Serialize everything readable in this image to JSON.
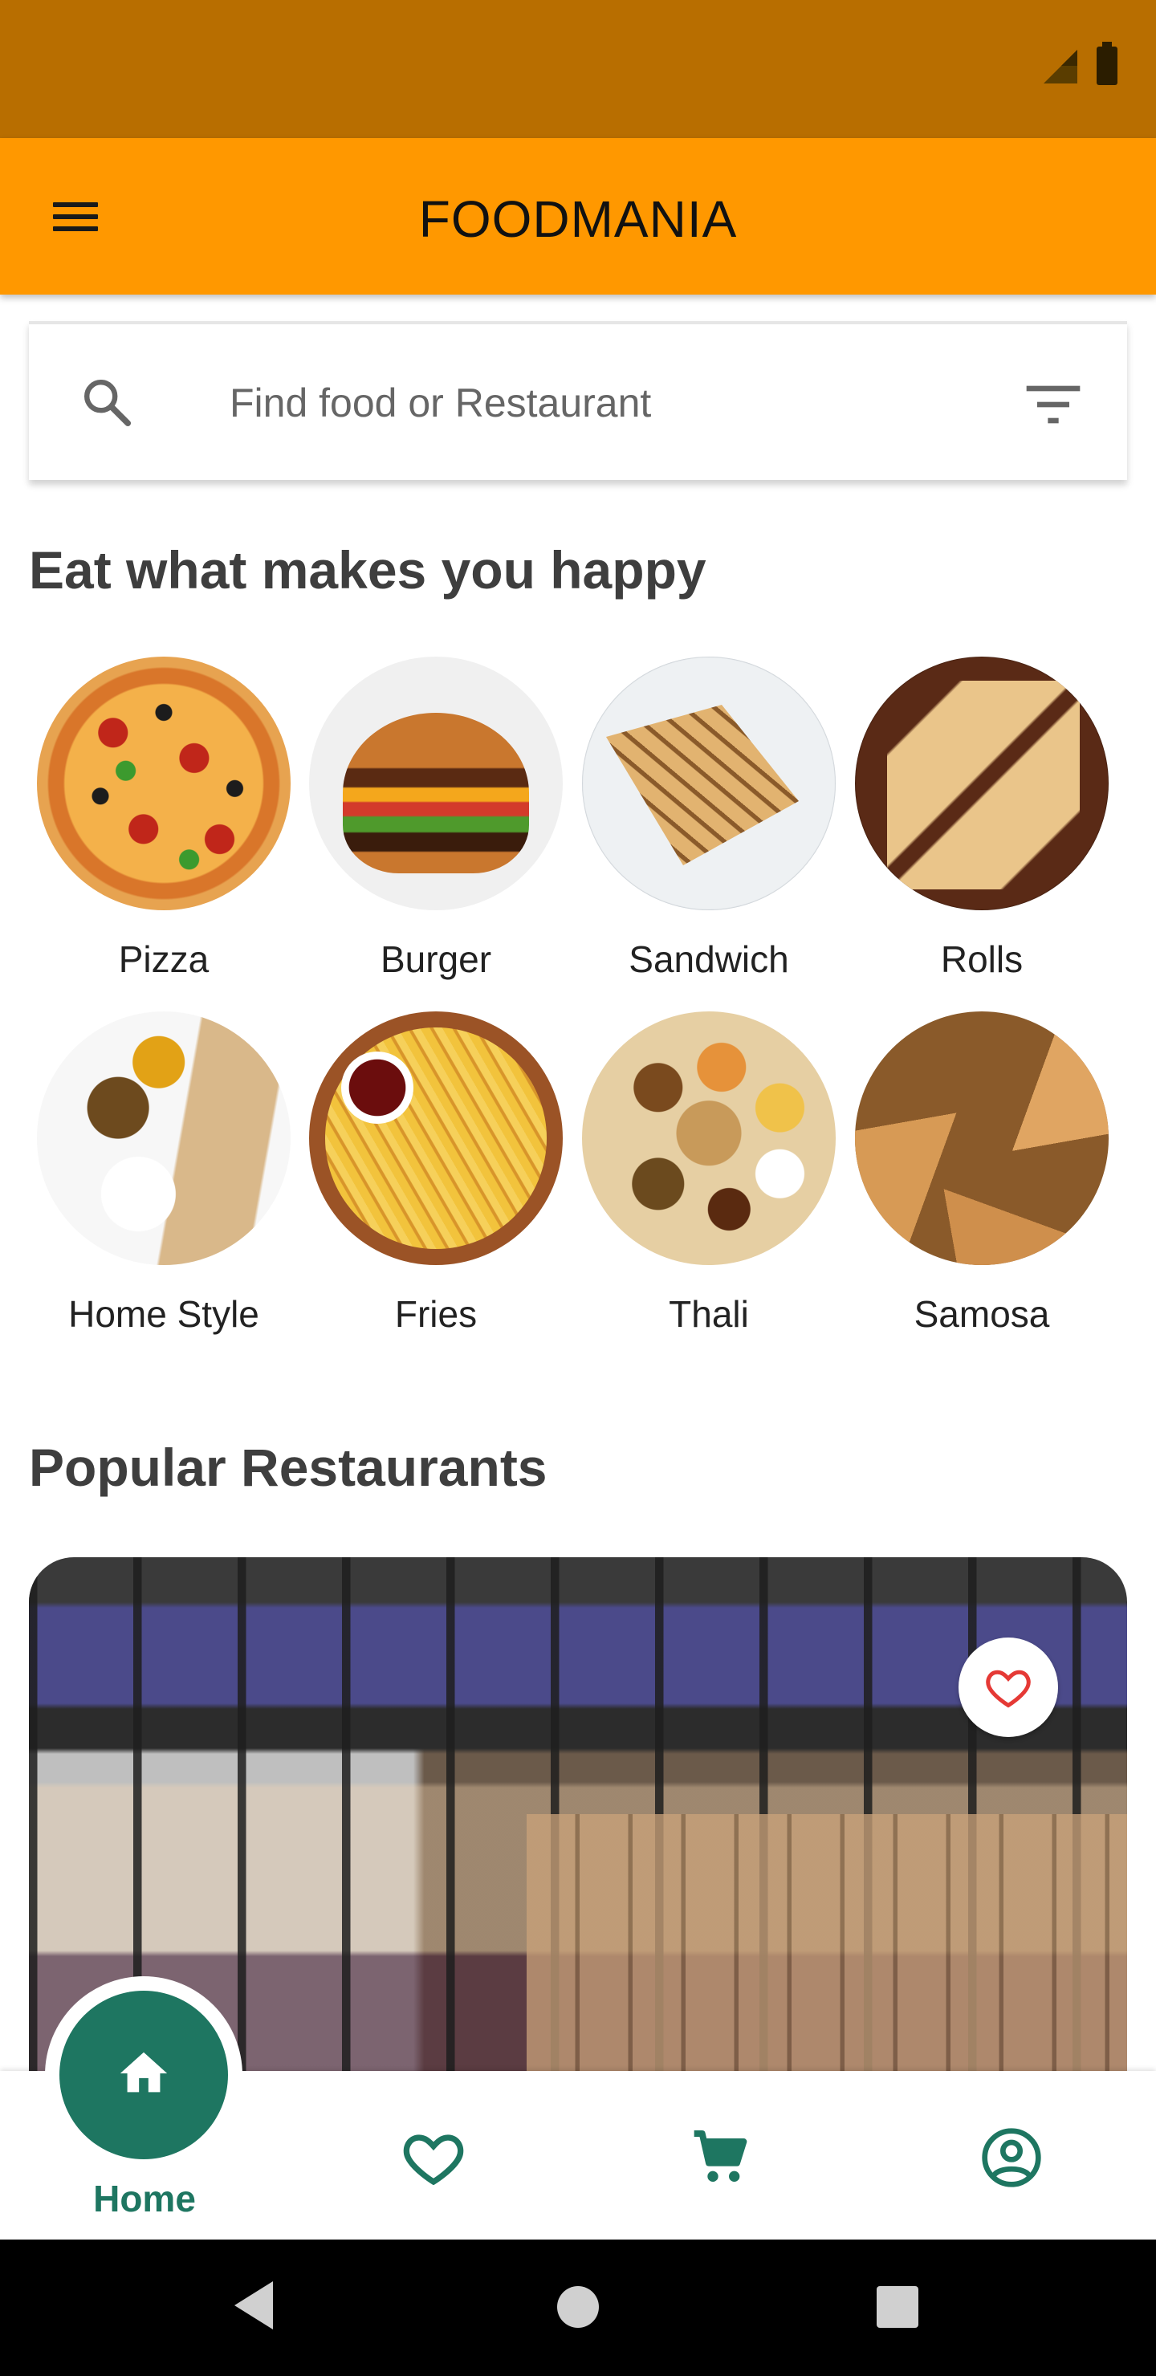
{
  "app": {
    "title": "FOODMANIA"
  },
  "search": {
    "placeholder": "Find food or Restaurant"
  },
  "sections": {
    "eat_title": "Eat what makes you happy",
    "popular_title": "Popular Restaurants"
  },
  "categories": [
    {
      "label": "Pizza",
      "icon": "pizza"
    },
    {
      "label": "Burger",
      "icon": "burger"
    },
    {
      "label": "Sandwich",
      "icon": "sandwich"
    },
    {
      "label": "Rolls",
      "icon": "rolls"
    },
    {
      "label": "Home Style",
      "icon": "home-style-meal"
    },
    {
      "label": "Fries",
      "icon": "fries"
    },
    {
      "label": "Thali",
      "icon": "thali"
    },
    {
      "label": "Samosa",
      "icon": "samosa"
    }
  ],
  "bottom_nav": {
    "home_label": "Home",
    "items": [
      "home-icon",
      "heart-icon",
      "cart-icon",
      "account-icon"
    ]
  },
  "colors": {
    "status_bar": "#b86e00",
    "app_bar": "#ff9800",
    "accent_green": "#1e7661",
    "favorite_red": "#e53935"
  }
}
